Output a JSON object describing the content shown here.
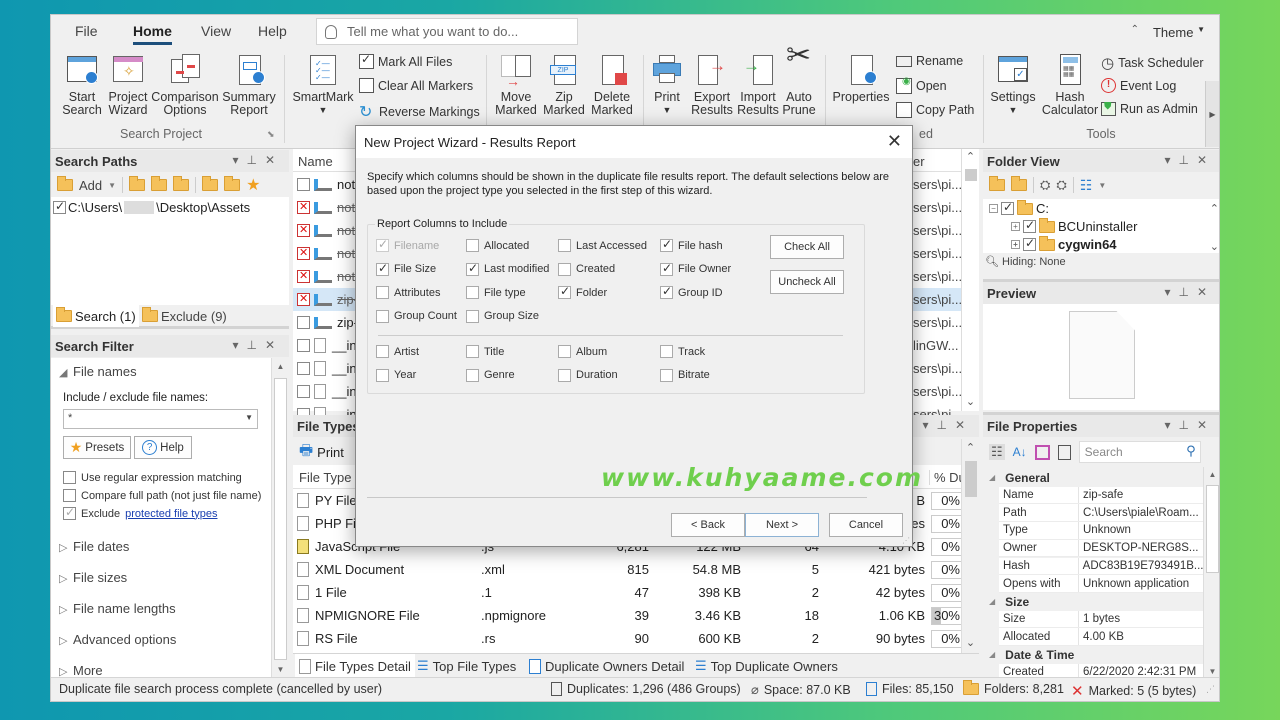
{
  "ribbon": {
    "tabs": [
      "File",
      "Home",
      "View",
      "Help"
    ],
    "active_tab": "Home",
    "tell_me_placeholder": "Tell me what you want to do...",
    "theme_label": "Theme",
    "buttons": {
      "start_search": [
        "Start",
        "Search"
      ],
      "project_wizard": [
        "Project",
        "Wizard"
      ],
      "comparison_options": [
        "Comparison",
        "Options"
      ],
      "summary_report": [
        "Summary",
        "Report"
      ],
      "smartmark": "SmartMark",
      "mark_all": "Mark All Files",
      "clear_all": "Clear All Markers",
      "reverse": "Reverse Markings",
      "move_marked": [
        "Move",
        "Marked"
      ],
      "zip_marked": [
        "Zip",
        "Marked"
      ],
      "delete_marked": [
        "Delete",
        "Marked"
      ],
      "print": "Print",
      "export_results": [
        "Export",
        "Results"
      ],
      "import_results": [
        "Import",
        "Results"
      ],
      "auto_prune": [
        "Auto",
        "Prune"
      ],
      "properties": "Properties",
      "rename": "Rename",
      "open": "Open",
      "copy_path": "Copy Path",
      "settings": "Settings",
      "hash_calculator": [
        "Hash",
        "Calculator"
      ],
      "task_scheduler": "Task Scheduler",
      "event_log": "Event Log",
      "run_as_admin": "Run as Admin"
    },
    "groups": {
      "search_project": "Search Project",
      "selected": "ed",
      "tools": "Tools"
    }
  },
  "search_paths": {
    "title": "Search Paths",
    "add_label": "Add",
    "paths": [
      {
        "checked": true,
        "prefix": "C:\\Users\\",
        "suffix": "\\Desktop\\Assets"
      }
    ],
    "tabs": [
      "Search (1)",
      "Exclude (9)"
    ]
  },
  "search_filter": {
    "title": "Search Filter",
    "file_names_label": "File names",
    "include_label": "Include / exclude file names:",
    "include_value": "*",
    "presets_label": "Presets",
    "help_label": "Help",
    "options": [
      {
        "label": "Use regular expression matching",
        "checked": false
      },
      {
        "label": "Compare full path (not just file name)",
        "checked": false
      },
      {
        "label": "Exclude",
        "link": "protected file types",
        "checked": true
      }
    ],
    "sections": [
      "File dates",
      "File sizes",
      "File name lengths",
      "Advanced options",
      "More"
    ]
  },
  "results": {
    "name_header": "Name",
    "folder_header": "er",
    "rows": [
      {
        "name": "not-z",
        "mark": "none",
        "strike": false,
        "folder": "sers\\pi...",
        "icon": "app"
      },
      {
        "name": "not-z",
        "mark": "x",
        "strike": true,
        "folder": "sers\\pi...",
        "icon": "app"
      },
      {
        "name": "not-z",
        "mark": "x",
        "strike": true,
        "folder": "sers\\pi...",
        "icon": "app"
      },
      {
        "name": "not-z",
        "mark": "x",
        "strike": true,
        "folder": "sers\\pi...",
        "icon": "app"
      },
      {
        "name": "not-z",
        "mark": "x",
        "strike": true,
        "folder": "sers\\pi...",
        "icon": "app"
      },
      {
        "name": "zip-s",
        "mark": "x",
        "strike": true,
        "folder": "sers\\pi...",
        "icon": "app",
        "selected": true
      },
      {
        "name": "zip-s",
        "mark": "none",
        "strike": false,
        "folder": "sers\\pi...",
        "icon": "app"
      },
      {
        "name": "__init",
        "mark": "none",
        "strike": false,
        "folder": "linGW...",
        "icon": "file"
      },
      {
        "name": "__init",
        "mark": "none",
        "strike": false,
        "folder": "sers\\pi...",
        "icon": "file"
      },
      {
        "name": "__init",
        "mark": "none",
        "strike": false,
        "folder": "sers\\pi...",
        "icon": "file"
      },
      {
        "name": "__init",
        "mark": "none",
        "strike": false,
        "folder": "sers\\pi...",
        "icon": "file"
      }
    ]
  },
  "file_types": {
    "title": "File Types",
    "print_label": "Print",
    "col_type": "File Type",
    "col_pct": "% Du",
    "rows": [
      {
        "type": "PY File",
        "ext": "",
        "count": "",
        "size": "",
        "groups": "",
        "avg": "B",
        "pct": "0%"
      },
      {
        "type": "PHP File",
        "ext": "",
        "count": "",
        "size": "",
        "groups": "",
        "avg": "es",
        "pct": "0%"
      },
      {
        "type": "JavaScript File",
        "ext": ".js",
        "count": "6,281",
        "size": "122 MB",
        "groups": "64",
        "avg": "4.10 KB",
        "pct": "0%"
      },
      {
        "type": "XML Document",
        "ext": ".xml",
        "count": "815",
        "size": "54.8 MB",
        "groups": "5",
        "avg": "421 bytes",
        "pct": "0%"
      },
      {
        "type": "1 File",
        "ext": ".1",
        "count": "47",
        "size": "398 KB",
        "groups": "2",
        "avg": "42 bytes",
        "pct": "0%"
      },
      {
        "type": "NPMIGNORE File",
        "ext": ".npmignore",
        "count": "39",
        "size": "3.46 KB",
        "groups": "18",
        "avg": "1.06 KB",
        "pct": "30%",
        "pct_fill": 0.3
      },
      {
        "type": "RS File",
        "ext": ".rs",
        "count": "90",
        "size": "600 KB",
        "groups": "2",
        "avg": "90 bytes",
        "pct": "0%"
      }
    ],
    "tabs": [
      "File Types Detail",
      "Top File Types",
      "Duplicate Owners Detail",
      "Top Duplicate Owners"
    ]
  },
  "folder_view": {
    "title": "Folder View",
    "tree": [
      {
        "label": "C:",
        "level": 0,
        "bold": false
      },
      {
        "label": "BCUninstaller",
        "level": 1,
        "bold": false
      },
      {
        "label": "cygwin64",
        "level": 1,
        "bold": true
      }
    ],
    "hiding": "Hiding: None"
  },
  "preview": {
    "title": "Preview"
  },
  "file_properties": {
    "title": "File Properties",
    "search_placeholder": "Search",
    "categories": [
      {
        "name": "General",
        "rows": [
          {
            "k": "Name",
            "v": "zip-safe"
          },
          {
            "k": "Path",
            "v": "C:\\Users\\piale\\Roam..."
          },
          {
            "k": "Type",
            "v": "Unknown"
          },
          {
            "k": "Owner",
            "v": "DESKTOP-NERG8S..."
          },
          {
            "k": "Hash",
            "v": "ADC83B19E793491B..."
          },
          {
            "k": "Opens with",
            "v": "Unknown application"
          }
        ]
      },
      {
        "name": "Size",
        "rows": [
          {
            "k": "Size",
            "v": "1 bytes"
          },
          {
            "k": "Allocated",
            "v": "4.00 KB"
          }
        ]
      },
      {
        "name": "Date & Time",
        "rows": [
          {
            "k": "Created",
            "v": "6/22/2020 2:42:31 PM"
          }
        ]
      }
    ]
  },
  "dialog": {
    "title": "New Project Wizard - Results Report",
    "description": "Specify which columns should be shown in the duplicate file results report. The default selections below are based upon the project type you selected in the first step of this wizard.",
    "group_label": "Report Columns to Include",
    "columns": [
      {
        "label": "Filename",
        "checked": true,
        "disabled": true
      },
      {
        "label": "Allocated",
        "checked": false
      },
      {
        "label": "Last Accessed",
        "checked": false
      },
      {
        "label": "File hash",
        "checked": true
      },
      {
        "label": "File Size",
        "checked": true
      },
      {
        "label": "Last modified",
        "checked": true
      },
      {
        "label": "Created",
        "checked": false
      },
      {
        "label": "File Owner",
        "checked": true
      },
      {
        "label": "Attributes",
        "checked": false
      },
      {
        "label": "File type",
        "checked": false
      },
      {
        "label": "Folder",
        "checked": true
      },
      {
        "label": "Group ID",
        "checked": true
      },
      {
        "label": "Group Count",
        "checked": false
      },
      {
        "label": "Group Size",
        "checked": false
      }
    ],
    "media_columns": [
      {
        "label": "Artist",
        "checked": false
      },
      {
        "label": "Title",
        "checked": false
      },
      {
        "label": "Album",
        "checked": false
      },
      {
        "label": "Track",
        "checked": false
      },
      {
        "label": "Year",
        "checked": false
      },
      {
        "label": "Genre",
        "checked": false
      },
      {
        "label": "Duration",
        "checked": false
      },
      {
        "label": "Bitrate",
        "checked": false
      }
    ],
    "check_all": "Check All",
    "uncheck_all": "Uncheck All",
    "back": "< Back",
    "next": "Next >",
    "cancel": "Cancel"
  },
  "watermark": "www.kuhyaame.com",
  "status": {
    "message": "Duplicate file search process complete (cancelled by user)",
    "duplicates": "Duplicates: 1,296 (486 Groups)",
    "space": "Space: 87.0 KB",
    "files": "Files: 85,150",
    "folders": "Folders: 8,281",
    "marked": "Marked: 5 (5 bytes)"
  },
  "colors": {
    "accent": "#1d4f7c",
    "selection": "#d5e7f7",
    "link": "#1a3fb0",
    "watermark": "#6fcf4d"
  }
}
